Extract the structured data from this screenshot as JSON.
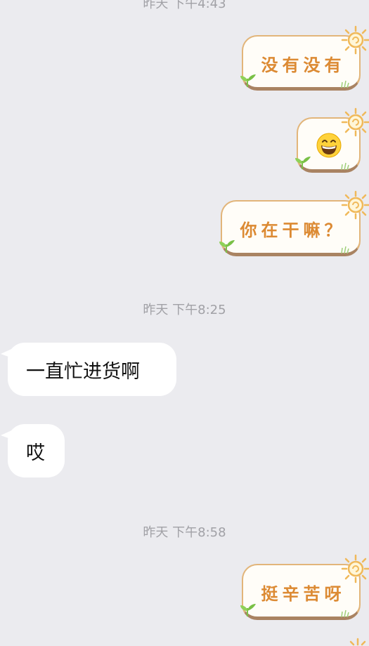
{
  "chat": {
    "timestamps": [
      "昨天 下午4:43",
      "昨天 下午8:25",
      "昨天 下午8:58"
    ],
    "messages": [
      {
        "side": "out",
        "text": "没有没有"
      },
      {
        "side": "out",
        "emoji": "grinning-face"
      },
      {
        "side": "out",
        "text": "你在干嘛？"
      },
      {
        "side": "in",
        "text": "一直忙进货啊"
      },
      {
        "side": "in",
        "text": "哎"
      },
      {
        "side": "out",
        "text": "挺辛苦呀"
      }
    ]
  },
  "colors": {
    "background": "#ebebef",
    "sticker_text": "#dc8a33",
    "sticker_border": "#e2b57a",
    "incoming_bubble": "#ffffff"
  }
}
